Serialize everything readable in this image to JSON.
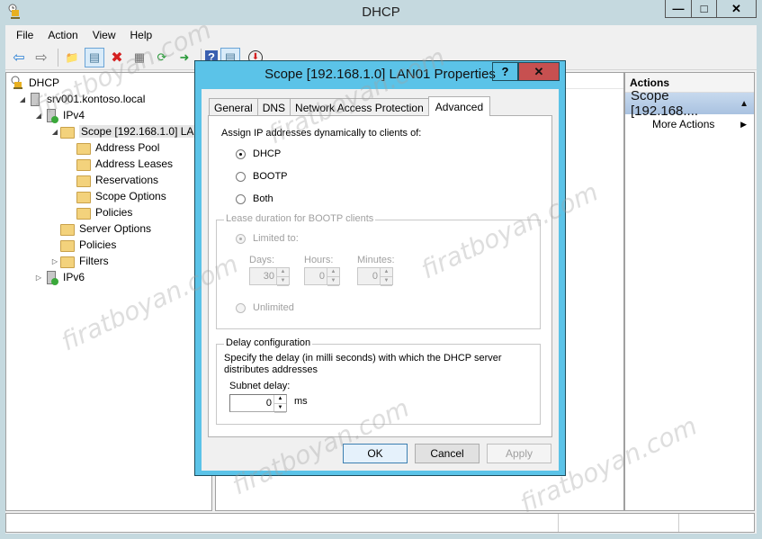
{
  "window": {
    "title": "DHCP",
    "controls": {
      "minimize": "—",
      "maximize": "□",
      "close": "✕"
    }
  },
  "menu": [
    "File",
    "Action",
    "View",
    "Help"
  ],
  "toolbar": [
    {
      "name": "back-icon",
      "glyph": "⇦"
    },
    {
      "name": "forward-icon",
      "glyph": "⇨"
    },
    {
      "name": "up-folder-icon",
      "glyph": "📁"
    },
    {
      "name": "show-hide-console-tree-icon",
      "glyph": "▤",
      "selected": true
    },
    {
      "name": "delete-icon",
      "glyph": "✖"
    },
    {
      "name": "properties-icon",
      "glyph": "▦"
    },
    {
      "name": "refresh-icon",
      "glyph": "⟳"
    },
    {
      "name": "export-list-icon",
      "glyph": "➜"
    },
    {
      "name": "help-icon",
      "glyph": "?"
    },
    {
      "name": "show-hide-action-pane-icon",
      "glyph": "▤",
      "selected": true
    },
    {
      "name": "deactivate-icon",
      "glyph": "⬇"
    }
  ],
  "tree": [
    {
      "label": "DHCP",
      "level": 0,
      "expander": "",
      "icon": "dhcp-icon"
    },
    {
      "label": "srv001.kontoso.local",
      "level": 1,
      "expander": "◢",
      "icon": "server-icon"
    },
    {
      "label": "IPv4",
      "level": 2,
      "expander": "◢",
      "icon": "ipv4-server-icon"
    },
    {
      "label": "Scope [192.168.1.0] LAN01",
      "level": 3,
      "expander": "◢",
      "icon": "scope-folder-icon",
      "selected": true
    },
    {
      "label": "Address Pool",
      "level": 4,
      "expander": "",
      "icon": "address-pool-icon"
    },
    {
      "label": "Address Leases",
      "level": 4,
      "expander": "",
      "icon": "address-leases-icon"
    },
    {
      "label": "Reservations",
      "level": 4,
      "expander": "",
      "icon": "reservations-icon"
    },
    {
      "label": "Scope Options",
      "level": 4,
      "expander": "",
      "icon": "scope-options-icon"
    },
    {
      "label": "Policies",
      "level": 4,
      "expander": "",
      "icon": "policies-icon"
    },
    {
      "label": "Server Options",
      "level": 3,
      "expander": "",
      "icon": "server-options-icon"
    },
    {
      "label": "Policies",
      "level": 3,
      "expander": "",
      "icon": "policies-icon"
    },
    {
      "label": "Filters",
      "level": 3,
      "expander": "▷",
      "icon": "filters-icon"
    },
    {
      "label": "IPv6",
      "level": 2,
      "expander": "▷",
      "icon": "ipv6-server-icon"
    }
  ],
  "actions": {
    "title": "Actions",
    "scope_label": "Scope [192.168....",
    "scope_arrow": "▲",
    "more_actions": "More Actions",
    "more_arrow": "▶"
  },
  "dialog": {
    "title": "Scope [192.168.1.0] LAN01 Properties",
    "help": "?",
    "close": "✕",
    "tabs": [
      "General",
      "DNS",
      "Network Access Protection",
      "Advanced"
    ],
    "active_tab": "Advanced",
    "assign_label": "Assign IP addresses dynamically to clients of:",
    "assign_options": [
      {
        "label": "DHCP",
        "checked": true
      },
      {
        "label": "BOOTP",
        "checked": false
      },
      {
        "label": "Both",
        "checked": false
      }
    ],
    "lease_group": {
      "legend": "Lease duration for BOOTP clients",
      "limited_label": "Limited to:",
      "limited_checked": true,
      "days_label": "Days:",
      "days_value": "30",
      "hours_label": "Hours:",
      "hours_value": "0",
      "minutes_label": "Minutes:",
      "minutes_value": "0",
      "unlimited_label": "Unlimited",
      "unlimited_checked": false
    },
    "delay_group": {
      "legend": "Delay configuration",
      "description": "Specify the delay (in milli seconds) with which the DHCP server distributes addresses",
      "subnet_delay_label": "Subnet delay:",
      "subnet_delay_value": "0",
      "unit": "ms"
    },
    "buttons": {
      "ok": "OK",
      "cancel": "Cancel",
      "apply": "Apply"
    }
  },
  "watermark": "firatboyan.com"
}
